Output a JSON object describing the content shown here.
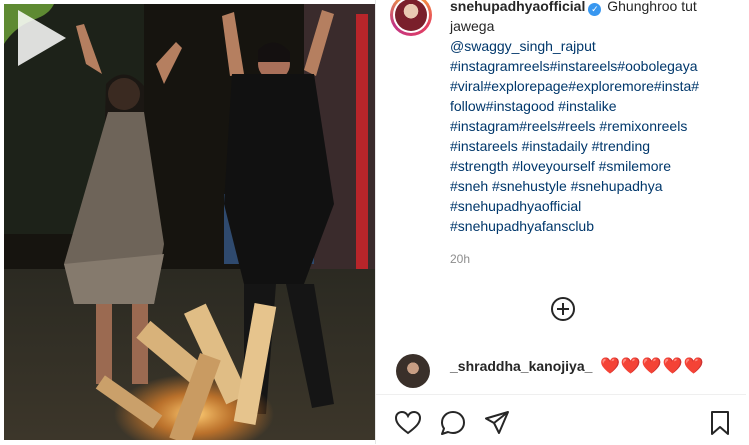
{
  "post": {
    "username": "snehupadhyaofficial",
    "verified_symbol": "✓",
    "caption_intro": "Ghunghroo tut jawega",
    "caption_lines": [
      "@swaggy_singh_rajput",
      "#instagramreels#instareels#oobolegaya",
      "#viral#explorepage#exploremore#insta#",
      "follow#instagood #instalike",
      "#instagram#reels#reels #remixonreels",
      "#instareels #instadaily #trending",
      "#strength #loveyourself #smilemore",
      "#sneh #snehustyle #snehupadhya",
      "#snehupadhyaofficial",
      "#snehupadhyafansclub"
    ],
    "time_ago": "20h"
  },
  "comment": {
    "username": "_shraddha_kanojiya_",
    "text": "❤️❤️❤️❤️❤️"
  },
  "icons": {
    "play": "play-icon",
    "more": "plus-circle-icon",
    "like": "heart-icon",
    "comment": "comment-icon",
    "share": "share-icon",
    "save": "bookmark-icon"
  },
  "colors": {
    "link": "#00376b",
    "text": "#262626",
    "muted": "#8e8e8e",
    "heart": "#e0245e"
  }
}
